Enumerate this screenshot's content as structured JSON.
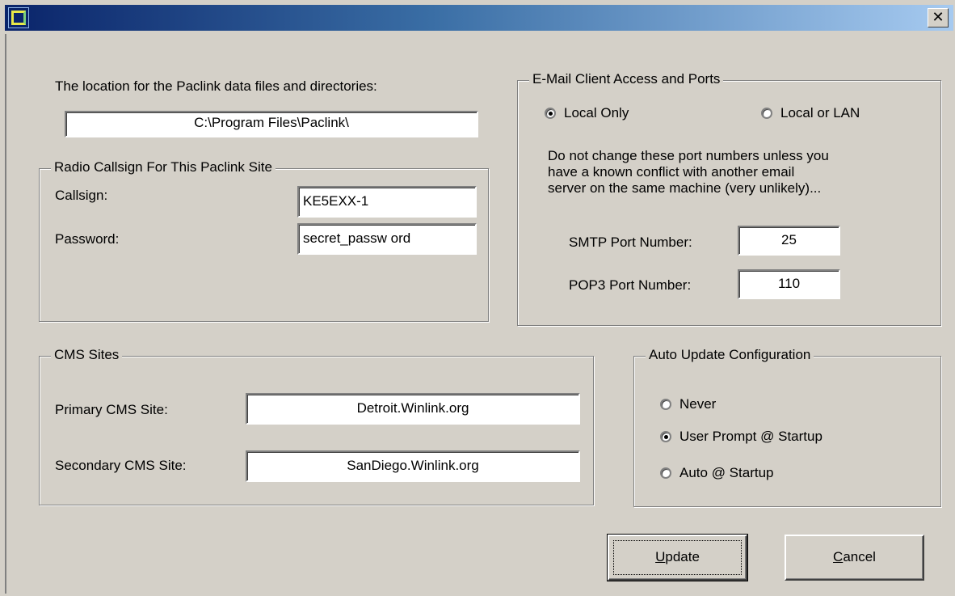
{
  "location": {
    "label": "The location for the Paclink data files and directories:",
    "path": "C:\\Program Files\\Paclink\\"
  },
  "radio": {
    "group_title": "Radio Callsign For This Paclink Site",
    "callsign_label": "Callsign:",
    "callsign_value": "KE5EXX-1",
    "password_label": "Password:",
    "password_value": "secret_passw ord"
  },
  "email": {
    "group_title": "E-Mail Client Access and Ports",
    "option_local": "Local Only",
    "option_lan": "Local or LAN",
    "selected": "Local Only",
    "note_line1": "Do not change these port numbers unless you",
    "note_line2": "have a known conflict with another email",
    "note_line3": "server on the same machine (very unlikely)...",
    "smtp_label": "SMTP Port Number:",
    "smtp_value": "25",
    "pop3_label": "POP3 Port Number:",
    "pop3_value": "110"
  },
  "cms": {
    "group_title": "CMS Sites",
    "primary_label": "Primary CMS Site:",
    "primary_value": "Detroit.Winlink.org",
    "secondary_label": "Secondary CMS Site:",
    "secondary_value": "SanDiego.Winlink.org"
  },
  "auto_update": {
    "group_title": "Auto Update Configuration",
    "options": [
      "Never",
      "User Prompt @ Startup",
      "Auto @ Startup"
    ],
    "selected": "User Prompt @ Startup"
  },
  "buttons": {
    "update_mnemonic": "U",
    "update_rest": "pdate",
    "cancel_mnemonic": "C",
    "cancel_rest": "ancel"
  },
  "titlebar": {
    "close_glyph": "✕"
  }
}
